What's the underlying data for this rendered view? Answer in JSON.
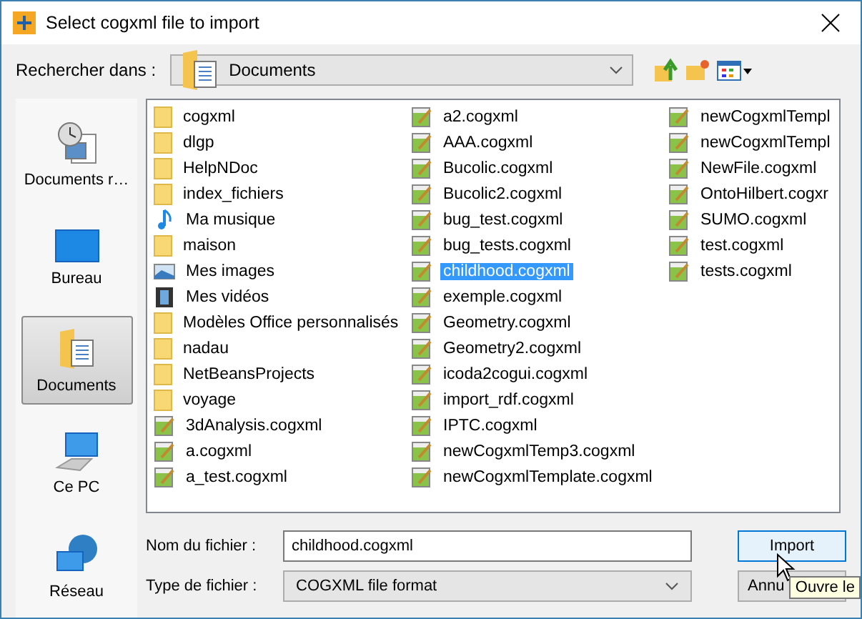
{
  "window": {
    "title": "Select cogxml file to import"
  },
  "look_in": {
    "label": "Rechercher dans :",
    "value": "Documents"
  },
  "places": [
    {
      "label": "Documents r…",
      "kind": "recent",
      "selected": false
    },
    {
      "label": "Bureau",
      "kind": "desktop",
      "selected": false
    },
    {
      "label": "Documents",
      "kind": "documents",
      "selected": true
    },
    {
      "label": "Ce PC",
      "kind": "pc",
      "selected": false
    },
    {
      "label": "Réseau",
      "kind": "network",
      "selected": false
    }
  ],
  "files": [
    {
      "name": "cogxml",
      "kind": "folder",
      "selected": false
    },
    {
      "name": "dlgp",
      "kind": "folder",
      "selected": false
    },
    {
      "name": "HelpNDoc",
      "kind": "folder",
      "selected": false
    },
    {
      "name": "index_fichiers",
      "kind": "folder",
      "selected": false
    },
    {
      "name": "Ma musique",
      "kind": "music",
      "selected": false
    },
    {
      "name": "maison",
      "kind": "folder",
      "selected": false
    },
    {
      "name": "Mes images",
      "kind": "images",
      "selected": false
    },
    {
      "name": "Mes vidéos",
      "kind": "videos",
      "selected": false
    },
    {
      "name": "Modèles Office personnalisés",
      "kind": "folder",
      "selected": false
    },
    {
      "name": "nadau",
      "kind": "folder",
      "selected": false
    },
    {
      "name": "NetBeansProjects",
      "kind": "folder",
      "selected": false
    },
    {
      "name": "voyage",
      "kind": "folder",
      "selected": false
    },
    {
      "name": "3dAnalysis.cogxml",
      "kind": "file",
      "selected": false
    },
    {
      "name": "a.cogxml",
      "kind": "file",
      "selected": false
    },
    {
      "name": "a_test.cogxml",
      "kind": "file",
      "selected": false
    },
    {
      "name": "a2.cogxml",
      "kind": "file",
      "selected": false
    },
    {
      "name": "AAA.cogxml",
      "kind": "file",
      "selected": false
    },
    {
      "name": "Bucolic.cogxml",
      "kind": "file",
      "selected": false
    },
    {
      "name": "Bucolic2.cogxml",
      "kind": "file",
      "selected": false
    },
    {
      "name": "bug_test.cogxml",
      "kind": "file",
      "selected": false
    },
    {
      "name": "bug_tests.cogxml",
      "kind": "file",
      "selected": false
    },
    {
      "name": "childhood.cogxml",
      "kind": "file",
      "selected": true
    },
    {
      "name": "exemple.cogxml",
      "kind": "file",
      "selected": false
    },
    {
      "name": "Geometry.cogxml",
      "kind": "file",
      "selected": false
    },
    {
      "name": "Geometry2.cogxml",
      "kind": "file",
      "selected": false
    },
    {
      "name": "icoda2cogui.cogxml",
      "kind": "file",
      "selected": false
    },
    {
      "name": "import_rdf.cogxml",
      "kind": "file",
      "selected": false
    },
    {
      "name": "IPTC.cogxml",
      "kind": "file",
      "selected": false
    },
    {
      "name": "newCogxmlTemp3.cogxml",
      "kind": "file",
      "selected": false
    },
    {
      "name": "newCogxmlTemplate.cogxml",
      "kind": "file",
      "selected": false
    },
    {
      "name": "newCogxmlTempl",
      "kind": "file",
      "selected": false
    },
    {
      "name": "newCogxmlTempl",
      "kind": "file",
      "selected": false
    },
    {
      "name": "NewFile.cogxml",
      "kind": "file",
      "selected": false
    },
    {
      "name": "OntoHilbert.cogxr",
      "kind": "file",
      "selected": false
    },
    {
      "name": "SUMO.cogxml",
      "kind": "file",
      "selected": false
    },
    {
      "name": "test.cogxml",
      "kind": "file",
      "selected": false
    },
    {
      "name": "tests.cogxml",
      "kind": "file",
      "selected": false
    }
  ],
  "file_name": {
    "label": "Nom du fichier :",
    "value": "childhood.cogxml"
  },
  "file_type": {
    "label": "Type de fichier :",
    "value": "COGXML file format"
  },
  "buttons": [
    {
      "label": "Import",
      "kind": "primary"
    },
    {
      "label": "Annu",
      "kind": "cancel"
    }
  ],
  "tooltip": "Ouvre le"
}
